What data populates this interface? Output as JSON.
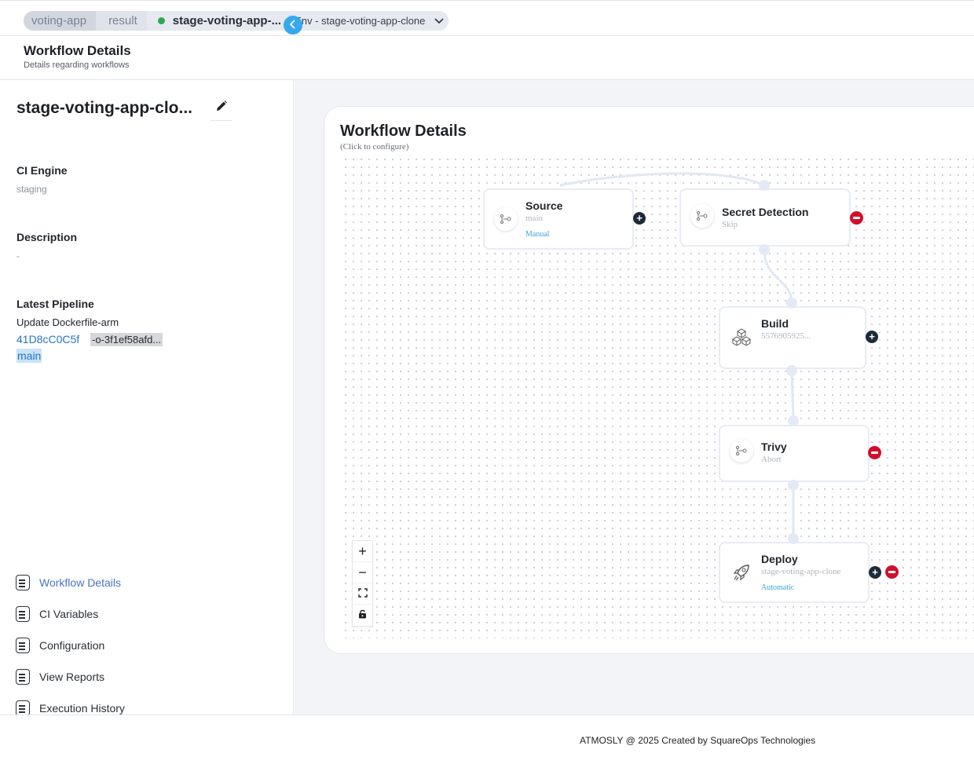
{
  "breadcrumb": {
    "project": "voting-app",
    "section": "result",
    "workflow": "stage-voting-app-...",
    "environment": "Env - stage-voting-app-clone",
    "status_color": "#2fa84f"
  },
  "header": {
    "title": "Workflow Details",
    "subtitle": "Details regarding workflows"
  },
  "sidebar": {
    "workflow_name": "stage-voting-app-clo...",
    "ci_engine_label": "CI Engine",
    "ci_engine_value": "staging",
    "description_label": "Description",
    "description_value": "-",
    "latest_pipeline_label": "Latest Pipeline",
    "pipeline_message": "Update Dockerfile-arm",
    "pipeline_id": "41D8cC0C5f",
    "commit_hash": "-o-3f1ef58afd...",
    "branch": "main",
    "nav": [
      {
        "label": "Workflow Details"
      },
      {
        "label": "CI Variables"
      },
      {
        "label": "Configuration"
      },
      {
        "label": "View Reports"
      },
      {
        "label": "Execution History"
      }
    ]
  },
  "workflow": {
    "title": "Workflow Details",
    "subtitle": "(Click to configure)",
    "nodes": {
      "source": {
        "title": "Source",
        "sub": "main",
        "link": "Manual",
        "icon": "git-branch-icon"
      },
      "secret": {
        "title": "Secret Detection",
        "sub": "Skip",
        "icon": "git-branch-icon"
      },
      "build": {
        "title": "Build",
        "sub": "5576905925...",
        "icon": "boxes-icon"
      },
      "trivy": {
        "title": "Trivy",
        "sub": "Abort",
        "icon": "git-branch-icon"
      },
      "deploy": {
        "title": "Deploy",
        "sub": "stage-voting-app-clone",
        "link": "Automatic",
        "icon": "rocket-icon"
      }
    },
    "zoom_controls": [
      "+",
      "−",
      "⛶",
      "🔓"
    ]
  },
  "footer": {
    "text": "ATMOSLY @ 2025 Created by SquareOps Technologies"
  }
}
